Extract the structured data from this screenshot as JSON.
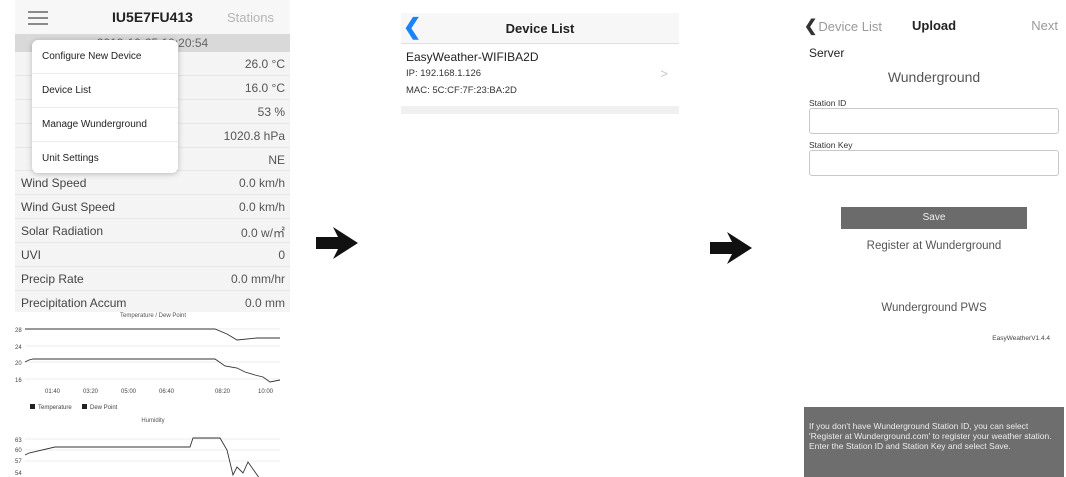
{
  "screen1": {
    "title": "IU5E7FU413",
    "stations_label": "Stations",
    "timestamp": "2019-10-25 10:20:54",
    "menu": [
      {
        "label": "Configure New Device"
      },
      {
        "label": "Device List"
      },
      {
        "label": "Manage Wunderground"
      },
      {
        "label": "Unit Settings"
      }
    ],
    "rows": [
      {
        "label": "",
        "value": "26.0 °C"
      },
      {
        "label": "",
        "value": "16.0 °C"
      },
      {
        "label": "",
        "value": "53 %"
      },
      {
        "label": "",
        "value": "1020.8 hPa"
      },
      {
        "label": "",
        "value": "NE"
      },
      {
        "label": "Wind Speed",
        "value": "0.0 km/h"
      },
      {
        "label": "Wind Gust Speed",
        "value": "0.0 km/h"
      },
      {
        "label": "Solar Radiation",
        "value": "0.0 w/㎡"
      },
      {
        "label": "UVI",
        "value": "0"
      },
      {
        "label": "Precip Rate",
        "value": "0.0 mm/hr"
      },
      {
        "label": "Precipitation Accum",
        "value": "0.0 mm"
      }
    ],
    "chart1": {
      "title": "Temperature / Dew Point",
      "y_ticks": [
        "28",
        "24",
        "20",
        "16"
      ],
      "x_ticks": [
        "01:40",
        "03:20",
        "05:00",
        "06:40",
        "08:20",
        "10:00"
      ],
      "legend": [
        "Temperature",
        "Dew Point"
      ]
    },
    "chart2": {
      "title": "Humidity",
      "y_ticks": [
        "63",
        "60",
        "57",
        "54"
      ]
    }
  },
  "screen2": {
    "back_icon": "chevron-left-icon",
    "title": "Device List",
    "device_name": "EasyWeather-WIFIBA2D",
    "ip": "IP: 192.168.1.126",
    "mac": "MAC: 5C:CF:7F:23:BA:2D",
    "chevron": ">"
  },
  "screen3": {
    "back_label": "Device List",
    "title": "Upload",
    "next_label": "Next",
    "server_label": "Server",
    "server_value": "Wunderground",
    "station_id_label": "Station ID",
    "station_key_label": "Station Key",
    "save_label": "Save",
    "register_label": "Register at Wunderground",
    "pws_label": "Wunderground PWS",
    "version": "EasyWeatherV1.4.4",
    "help_text": "If you don't have Wunderground Station ID, you can select 'Register at Wunderground.com' to register your weather station.\nEnter the Station ID and Station Key and select Save."
  },
  "colors": {
    "accent_blue": "#1a82fb",
    "save_button": "#6b6b6b",
    "help_banner": "#6e6e6e"
  }
}
